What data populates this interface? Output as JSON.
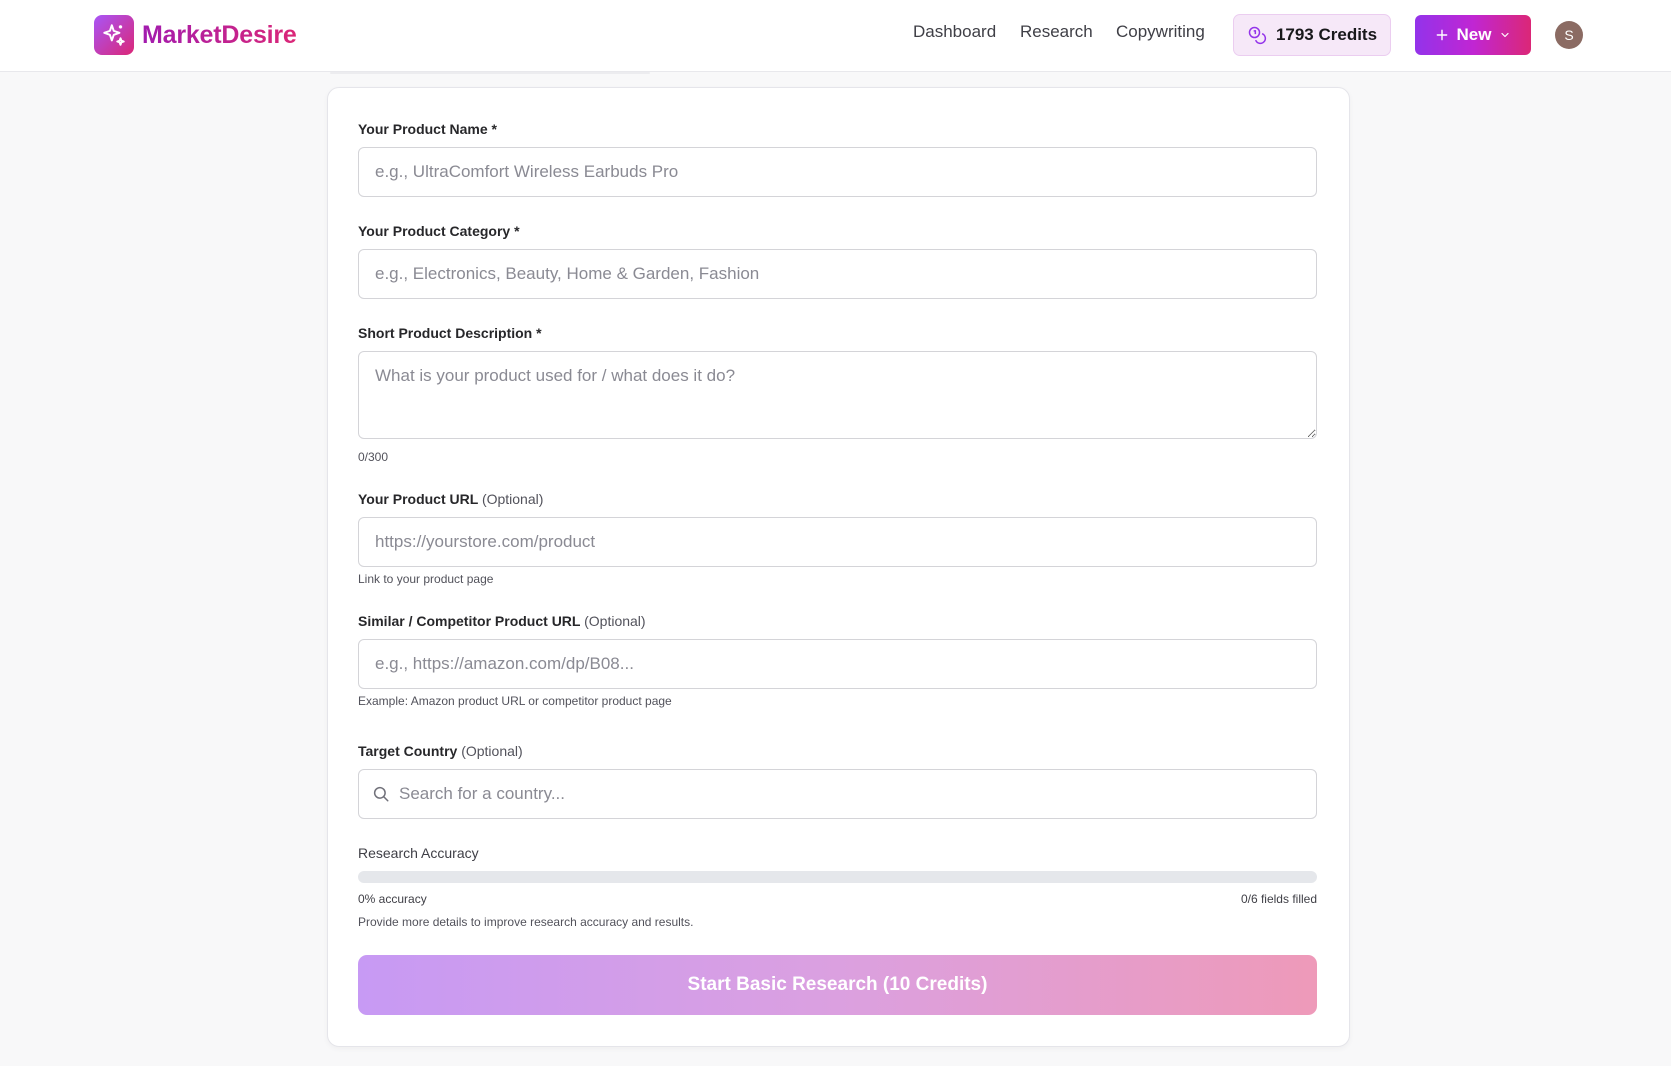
{
  "header": {
    "brand": "MarketDesire",
    "nav": [
      "Dashboard",
      "Research",
      "Copywriting"
    ],
    "credits_label": "1793 Credits",
    "new_button": "New",
    "avatar_initial": "S"
  },
  "form": {
    "product_name": {
      "label": "Your Product Name *",
      "placeholder": "e.g., UltraComfort Wireless Earbuds Pro",
      "value": ""
    },
    "product_category": {
      "label": "Your Product Category *",
      "placeholder": "e.g., Electronics, Beauty, Home & Garden, Fashion",
      "value": ""
    },
    "description": {
      "label": "Short Product Description *",
      "placeholder": "What is your product used for / what does it do?",
      "value": "",
      "counter": "0/300"
    },
    "product_url": {
      "label": "Your Product URL",
      "optional": "(Optional)",
      "placeholder": "https://yourstore.com/product",
      "value": "",
      "hint": "Link to your product page"
    },
    "competitor_url": {
      "label": "Similar / Competitor Product URL",
      "optional": "(Optional)",
      "placeholder": "e.g., https://amazon.com/dp/B08...",
      "value": "",
      "hint": "Example: Amazon product URL or competitor product page"
    },
    "country": {
      "label": "Target Country",
      "optional": "(Optional)",
      "placeholder": "Search for a country...",
      "value": ""
    },
    "accuracy": {
      "label": "Research Accuracy",
      "percent": 0,
      "percent_text": "0% accuracy",
      "fields_text": "0/6 fields filled",
      "note": "Provide more details to improve research accuracy and results."
    },
    "submit_label": "Start Basic Research (10 Credits)"
  },
  "colors": {
    "brand_start": "#a855f7",
    "brand_end": "#db2777",
    "credits_bg": "#f6e8f8"
  }
}
